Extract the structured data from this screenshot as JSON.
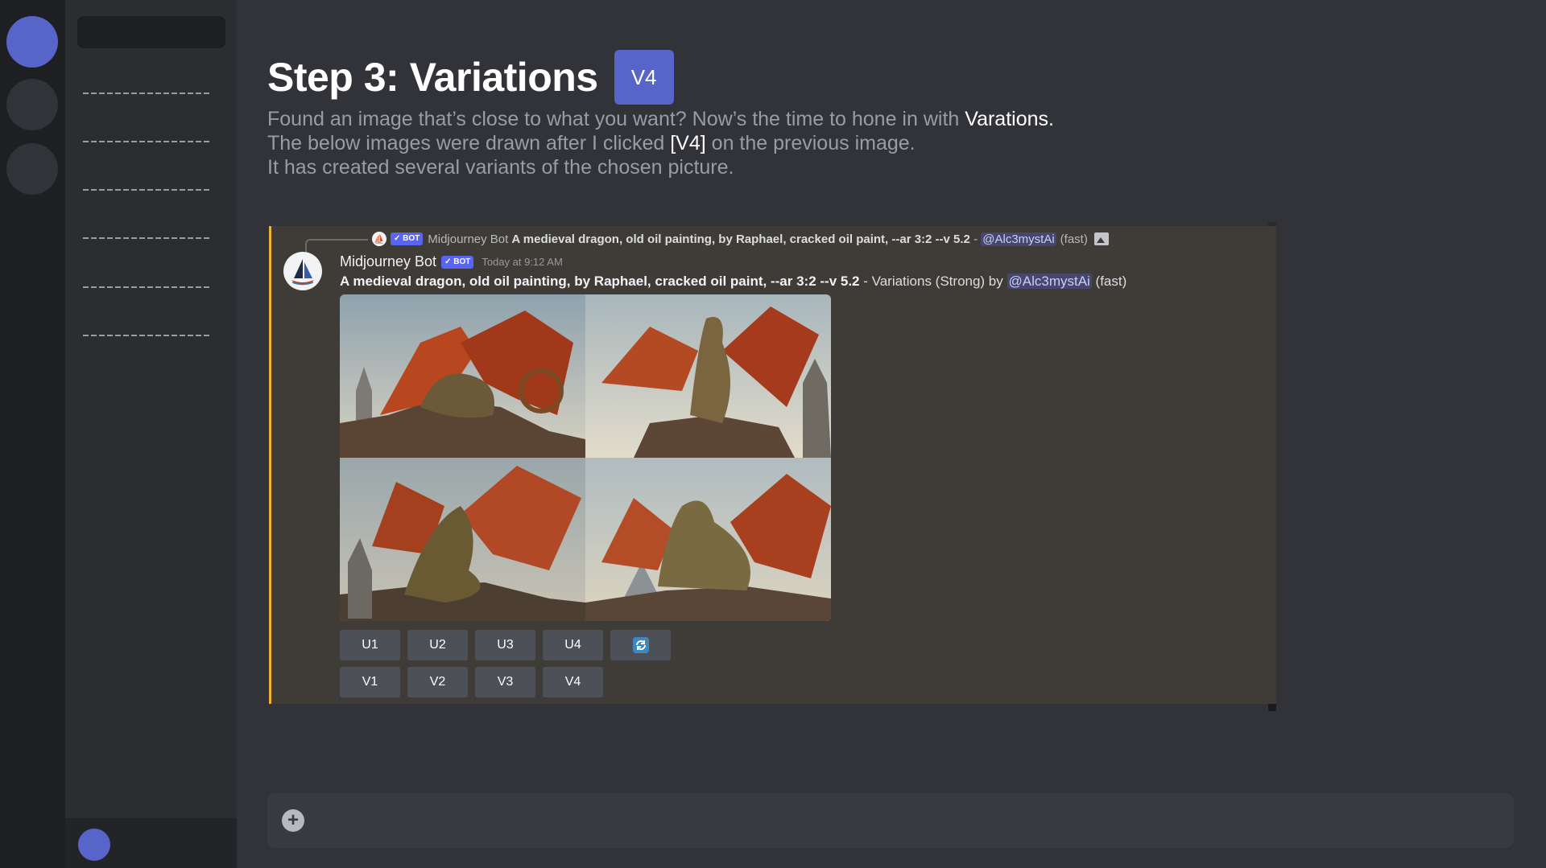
{
  "servers": [
    "",
    "",
    ""
  ],
  "channels": [
    "----------------",
    "----------------",
    "----------------",
    "----------------",
    "----------------",
    "----------------"
  ],
  "heading": {
    "title": "Step 3: Variations",
    "chip": "V4",
    "desc_line1_text": "Found an image that’s close to what you want? Now’s the time to hone in with",
    "desc_line1_bold": "Varations.",
    "desc_line2_a": "The below images were drawn after I clicked",
    "desc_line2_bold": "[V4]",
    "desc_line2_b": "on the previous image.",
    "desc_line3": "It has created several variants of the chosen picture."
  },
  "reply": {
    "bot_tag": "✓ BOT",
    "author": "Midjourney Bot",
    "prompt": "A medieval dragon, old oil painting, by Raphael, cracked oil paint, --ar 3:2 --v 5.2",
    "separator": " - ",
    "mention": "@Alc3mystAi",
    "speed": "(fast)"
  },
  "message": {
    "author": "Midjourney Bot",
    "bot_tag": "✓ BOT",
    "timestamp": "Today at 9:12 AM",
    "prompt": "A medieval dragon, old oil painting, by Raphael, cracked oil paint, --ar 3:2 --v 5.2",
    "suffix": " - Variations (Strong) by ",
    "mention": "@Alc3mystAi",
    "speed": " (fast)"
  },
  "buttons_row1": [
    "U1",
    "U2",
    "U3",
    "U4"
  ],
  "refresh_icon": "refresh-icon",
  "buttons_row2": [
    "V1",
    "V2",
    "V3",
    "V4"
  ],
  "colors": {
    "accent": "#5865c8",
    "reply_bar": "#f0b232",
    "panel_bg": "#3f3b36"
  }
}
